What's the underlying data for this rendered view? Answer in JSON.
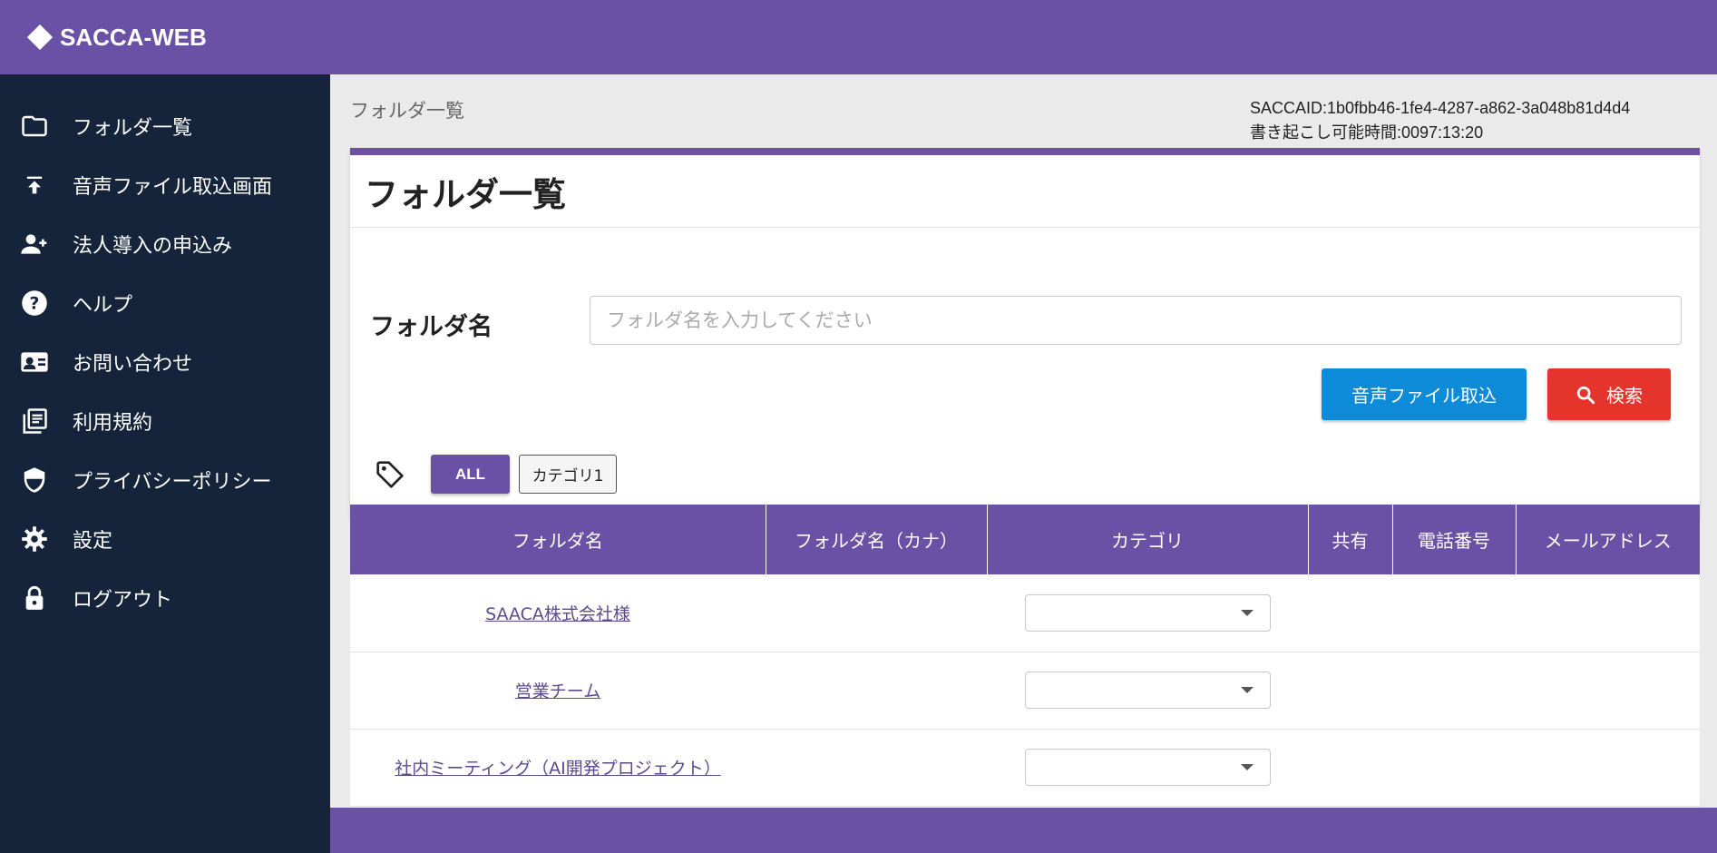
{
  "app": {
    "brand": "SACCA-WEB"
  },
  "sidebar": {
    "items": [
      {
        "label": "フォルダ一覧",
        "icon": "folder-icon"
      },
      {
        "label": "音声ファイル取込画面",
        "icon": "upload-icon"
      },
      {
        "label": "法人導入の申込み",
        "icon": "add-user-icon"
      },
      {
        "label": "ヘルプ",
        "icon": "help-icon"
      },
      {
        "label": "お問い合わせ",
        "icon": "contact-card-icon"
      },
      {
        "label": "利用規約",
        "icon": "terms-icon"
      },
      {
        "label": "プライバシーポリシー",
        "icon": "shield-icon"
      },
      {
        "label": "設定",
        "icon": "gear-icon"
      },
      {
        "label": "ログアウト",
        "icon": "lock-icon"
      }
    ]
  },
  "header": {
    "breadcrumb": "フォルダ一覧",
    "sacca_id": "SACCAID:1b0fbb46-1fe4-4287-a862-3a048b81d4d4",
    "remaining_time": "書き起こし可能時間:0097:13:20"
  },
  "card": {
    "title": "フォルダ一覧",
    "folder_label": "フォルダ名",
    "folder_placeholder": "フォルダ名を入力してください",
    "folder_value": "",
    "import_button": "音声ファイル取込",
    "search_button": "検索"
  },
  "filters": {
    "icon": "tag-icon",
    "chips": [
      "ALL",
      "カテゴリ1"
    ],
    "selected": "ALL"
  },
  "table": {
    "columns": [
      "フォルダ名",
      "フォルダ名（カナ）",
      "カテゴリ",
      "共有",
      "電話番号",
      "メールアドレス"
    ],
    "rows": [
      {
        "name": "SAACA株式会社様",
        "kana": "",
        "category": "",
        "share": "",
        "phone": "",
        "email": ""
      },
      {
        "name": "営業チーム",
        "kana": "",
        "category": "",
        "share": "",
        "phone": "",
        "email": ""
      },
      {
        "name": "社内ミーティング（AI開発プロジェクト）",
        "kana": "",
        "category": "",
        "share": "",
        "phone": "",
        "email": ""
      }
    ]
  },
  "colors": {
    "primary": "#6a51a5",
    "sidebar": "#15233b",
    "import": "#0d8bd8",
    "search": "#e5342c"
  }
}
